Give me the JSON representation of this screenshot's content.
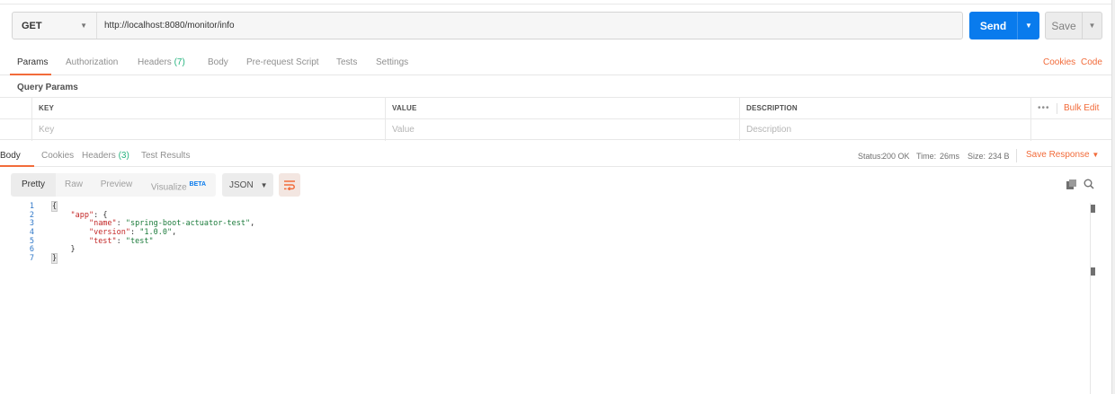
{
  "request": {
    "method": "GET",
    "url": "http://localhost:8080/monitor/info",
    "send_label": "Send",
    "save_label": "Save"
  },
  "request_tabs": {
    "params": "Params",
    "authorization": "Authorization",
    "headers": "Headers",
    "headers_count": "(7)",
    "body": "Body",
    "pre_request_script": "Pre-request Script",
    "tests": "Tests",
    "settings": "Settings",
    "cookies": "Cookies",
    "code": "Code"
  },
  "query_params": {
    "title": "Query Params",
    "columns": [
      "KEY",
      "VALUE",
      "DESCRIPTION"
    ],
    "placeholders": {
      "key": "Key",
      "value": "Value",
      "description": "Description"
    },
    "more": "•••",
    "bulk_edit": "Bulk Edit"
  },
  "response_tabs": {
    "body": "Body",
    "cookies": "Cookies",
    "headers": "Headers",
    "headers_count": "(3)",
    "test_results": "Test Results"
  },
  "response_meta": {
    "status_label": "Status:",
    "status_value": "200 OK",
    "time_label": "Time:",
    "time_value": "26ms",
    "size_label": "Size:",
    "size_value": "234 B",
    "save_response": "Save Response"
  },
  "body_toolbar": {
    "pretty": "Pretty",
    "raw": "Raw",
    "preview": "Preview",
    "visualize": "Visualize",
    "beta": "BETA",
    "format": "JSON"
  },
  "editor": {
    "line_numbers": [
      "1",
      "2",
      "3",
      "4",
      "5",
      "6",
      "7"
    ],
    "line1": "{",
    "app_key": "\"app\"",
    "app_rest": ": {",
    "name_key": "\"name\"",
    "name_value": "\"spring-boot-actuator-test\"",
    "version_key": "\"version\"",
    "version_value": "\"1.0.0\"",
    "test_key": "\"test\"",
    "test_value": "\"test\"",
    "line6": "}",
    "line7": "}"
  },
  "colors": {
    "accent": "#f26b3a",
    "send_blue": "#097bed",
    "success_green": "#26b47f"
  }
}
